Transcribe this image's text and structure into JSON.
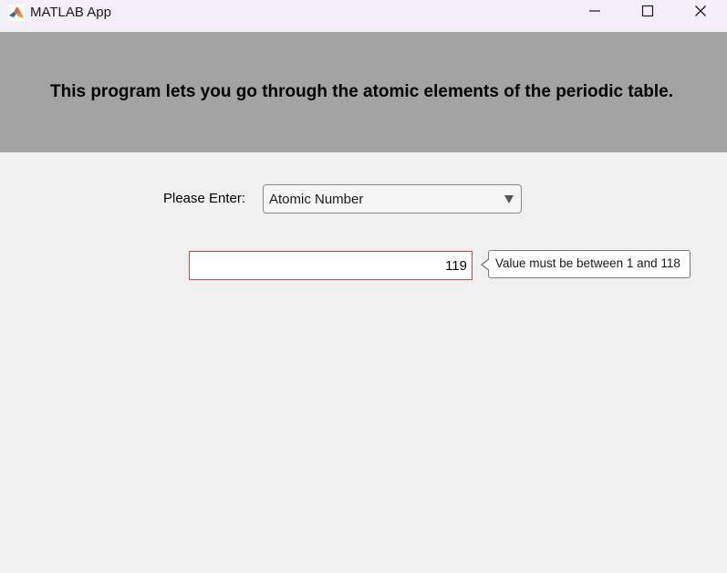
{
  "window": {
    "title": "MATLAB App",
    "icon": "matlab-logo-icon",
    "controls": [
      "minimize-icon",
      "maximize-icon",
      "close-icon"
    ]
  },
  "header": {
    "text": "This program lets you go through the atomic elements of the periodic table.",
    "background": "#a3a3a3"
  },
  "form": {
    "prompt_label": "Please Enter:",
    "mode_dropdown": {
      "selected": "Atomic Number"
    },
    "number_field": {
      "value": "119",
      "border_color": "#cc4747"
    },
    "validation_tooltip": {
      "message": "Value must be between 1 and 118"
    }
  }
}
